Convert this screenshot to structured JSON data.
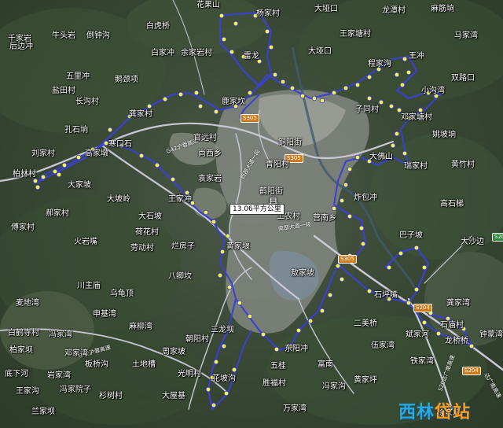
{
  "map": {
    "area_label": "13.06平方公里",
    "county_label": "县",
    "watermark": {
      "left": "西林",
      "right": "岱站"
    },
    "colors": {
      "boundary": "#3b3fd6",
      "markers": "#f4f44a",
      "road": "#c9c9d6",
      "shield": "#d07a1e"
    },
    "road_labels": [
      "S305",
      "S305",
      "南部大道一段",
      "G42沪蓉高速",
      "S305",
      "西部大道一段",
      "S204",
      "S204",
      "S204",
      "S20达广南高速",
      "达广南高速",
      "G42沪蓉高速"
    ],
    "places": [
      "花果山",
      "杨家村",
      "大垭口",
      "龙潭村",
      "麻筋垧",
      "千家岩",
      "白虎桥",
      "牛头岩",
      "倒钟沟",
      "王家塘村",
      "马家湾",
      "后边冲",
      "白家冲",
      "余家岩村",
      "雷龙",
      "大垭口",
      "程家沟",
      "王冲",
      "五里冲",
      "鹅颈项",
      "双路口",
      "盐田村",
      "长沟村",
      "小沟湾",
      "龚家村",
      "鹿家坎",
      "子同村",
      "邓家塘村",
      "孔石垧",
      "官远村",
      "姚坡垧",
      "刘家村",
      "高家墩",
      "铜阳街",
      "寒口石",
      "尚西乡",
      "青阳村",
      "大佛山",
      "黄竹村",
      "柏林村",
      "瑞家村",
      "大家坡",
      "袁家岩",
      "鹤阳街",
      "炸包冲",
      "高石梯",
      "大坡岭",
      "王家冲",
      "工农村",
      "营南乡",
      "郝家村",
      "大石坡",
      "巴子坡",
      "大沙边",
      "傅家村",
      "荷花村",
      "火岩嘴",
      "劳动村",
      "烂房子",
      "黄家堰",
      "敖家坡",
      "八卿坎",
      "川主庙",
      "石坪嘴",
      "乌龟顶",
      "麦地湾",
      "龚家湾",
      "申基湾",
      "麻柳湾",
      "三龙坝",
      "二美桥",
      "石庙村",
      "白鹤寺村",
      "冯家湾",
      "朝阳村",
      "斌家河",
      "钟蒙湾",
      "邓家湾",
      "板桥沟",
      "土地槽",
      "东阳冲",
      "伍家湾",
      "柏家坝",
      "周家坡",
      "五桂",
      "富南",
      "铁家湾",
      "底下河",
      "光明村",
      "花坡沟",
      "龙桥桥",
      "岩家湾",
      "黄家坪",
      "王家沟",
      "冯家院子",
      "胜福村",
      "冯家沟",
      "杉树村",
      "大屋基",
      "兰家坝",
      "万家湾",
      "徐家坝"
    ]
  }
}
